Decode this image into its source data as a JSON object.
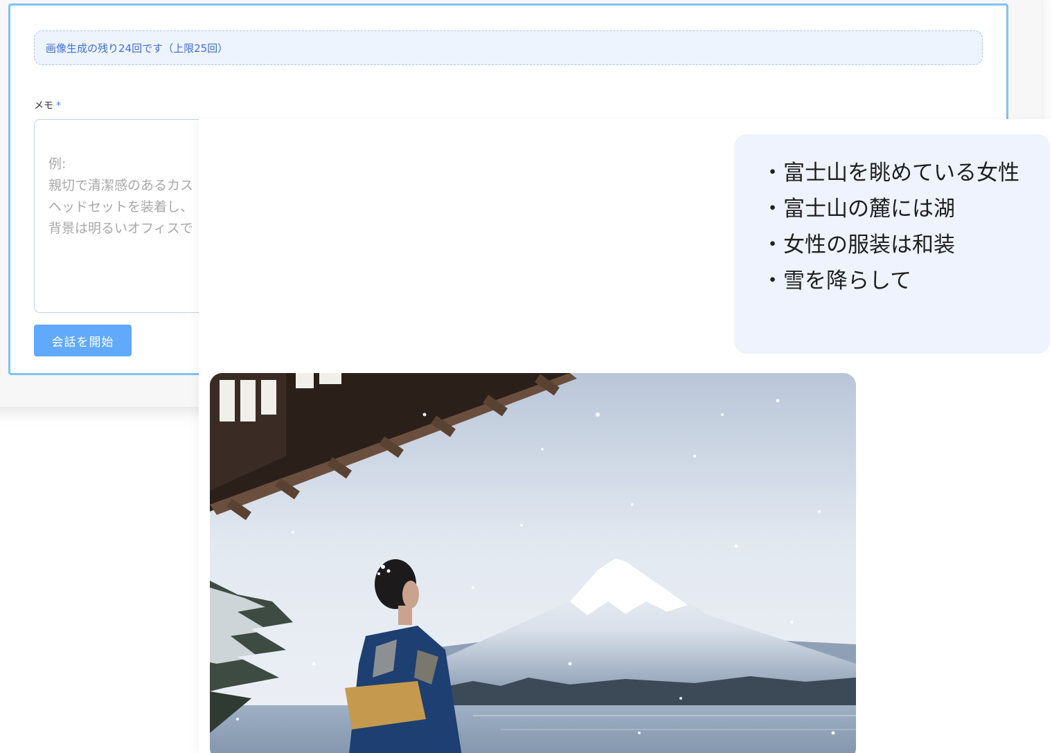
{
  "form": {
    "quota_notice": "画像生成の残り24回です（上限25回）",
    "memo_label": "メモ",
    "required_mark": "*",
    "memo_placeholder": "例:\n親切で清潔感のあるカス\nヘッドセットを装着し、\n背景は明るいオフィスで",
    "start_button_label": "会話を開始"
  },
  "chat": {
    "user_prompt_lines": [
      "・富士山を眺めている女性",
      "・富士山の麓には湖",
      "・女性の服装は和装",
      "・雪を降らして"
    ],
    "generated_image": {
      "subject": "woman-in-kimono-viewing-mount-fuji-snow-lake"
    }
  },
  "colors": {
    "card_border": "#7dc2f5",
    "banner_bg": "#eef4fd",
    "banner_text": "#3b6fd4",
    "button_bg": "#60a9fb",
    "bubble_bg": "#eef3fd"
  }
}
